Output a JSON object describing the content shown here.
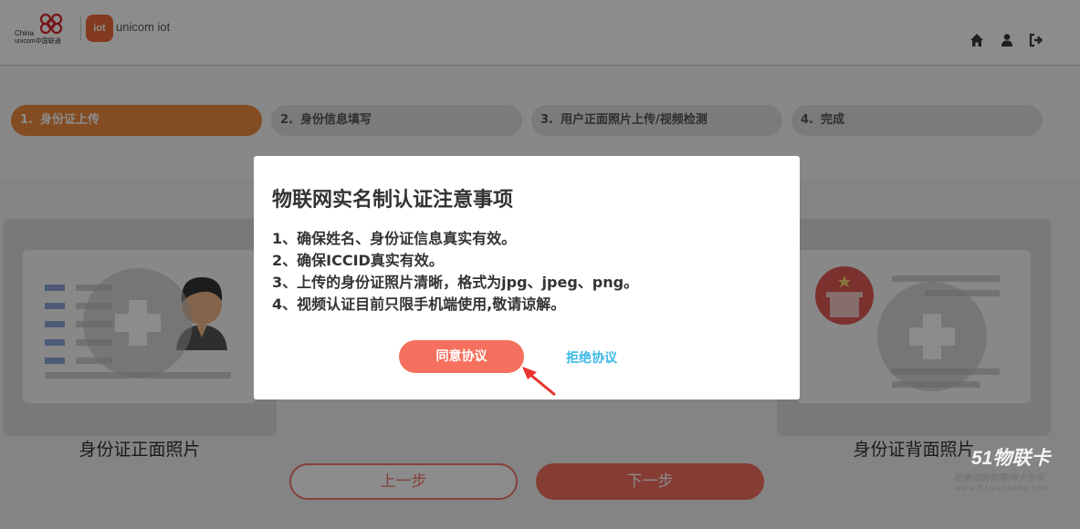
{
  "header": {
    "china_unicom_text_line1": "China",
    "china_unicom_text_line2": "unicom中国联通",
    "iot_badge": "iot",
    "iot_brand": "unicom iot",
    "icons": [
      "home-icon",
      "user-icon",
      "logout-icon"
    ]
  },
  "steps": [
    {
      "num": "1.",
      "label": "身份证上传",
      "active": true
    },
    {
      "num": "2.",
      "label": "身份信息填写",
      "active": false
    },
    {
      "num": "3.",
      "label": "用户正面照片上传/视频检测",
      "active": false
    },
    {
      "num": "4.",
      "label": "完成",
      "active": false
    }
  ],
  "cards": {
    "front_label": "身份证正面照片",
    "back_label": "身份证背面照片"
  },
  "buttons": {
    "prev": "上一步",
    "next": "下一步"
  },
  "modal": {
    "title": "物联网实名制认证注意事项",
    "items": [
      "1、确保姓名、身份证信息真实有效。",
      "2、确保ICCID真实有效。",
      "3、上传的身份证照片清晰，格式为jpg、jpeg、png。",
      "4、视频认证目前只限手机端使用,敬请谅解。"
    ],
    "agree": "同意协议",
    "reject": "拒绝协议"
  },
  "watermark": {
    "brand": "51物联卡",
    "slogan": "您身边的物联网卡专家",
    "url": "www.51wulianka.com"
  },
  "colors": {
    "step_active": "#ef8b3f",
    "agree_button": "#f5705e",
    "reject_link": "#3cb9e8",
    "next_button": "#f26d5e"
  }
}
